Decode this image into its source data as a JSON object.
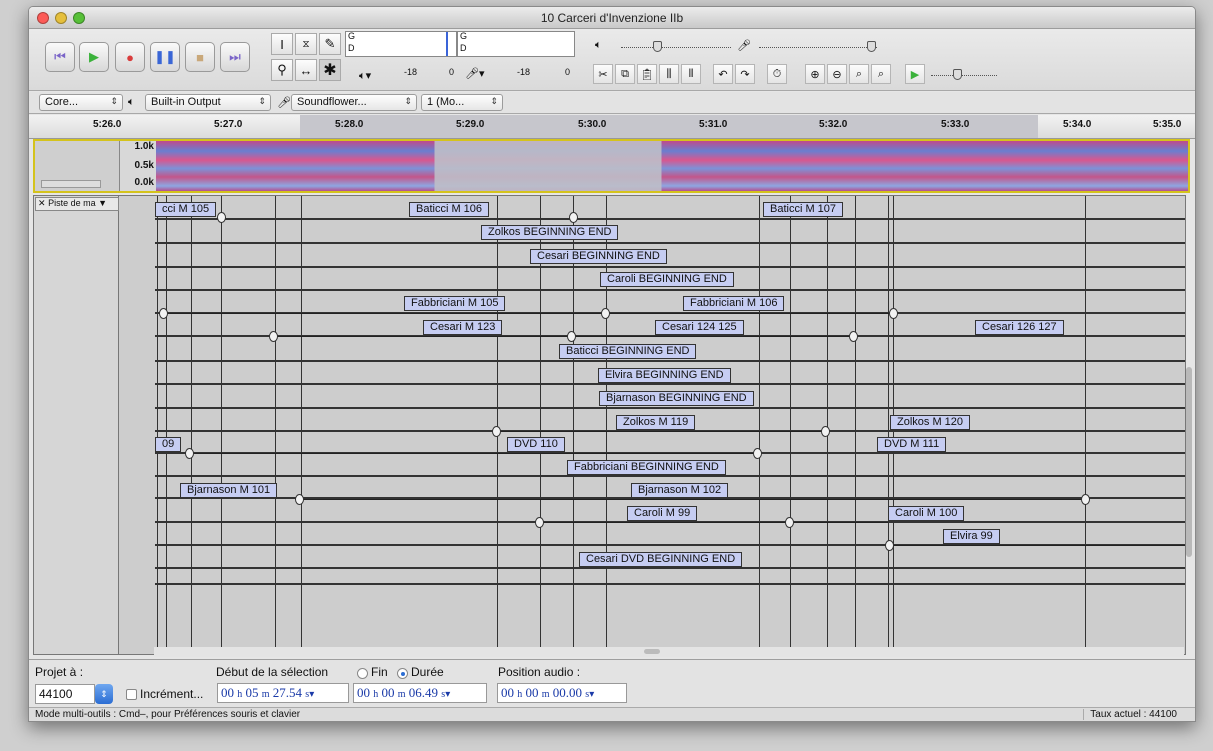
{
  "window": {
    "title": "10 Carceri d'Invenzione IIb"
  },
  "transport": {
    "skip_start": "skip-to-start",
    "play": "play",
    "record": "record",
    "pause": "pause",
    "stop": "stop",
    "skip_end": "skip-to-end"
  },
  "meters": {
    "play_meter_labels": [
      "G",
      "D"
    ],
    "record_meter_labels": [
      "G",
      "D"
    ],
    "play_scale": [
      "-18",
      "0"
    ],
    "record_scale": [
      "-18",
      "0"
    ]
  },
  "devices": {
    "host": "Core...",
    "output": "Built-in Output",
    "input": "Soundflower...",
    "channels": "1 (Mo..."
  },
  "ruler": {
    "ticks": [
      "5:26.0",
      "5:27.0",
      "5:28.0",
      "5:29.0",
      "5:30.0",
      "5:31.0",
      "5:32.0",
      "5:33.0",
      "5:34.0",
      "5:35.0"
    ]
  },
  "spectrogram": {
    "freq_labels": [
      "1.0k",
      "0.5k",
      "0.0k"
    ]
  },
  "label_track": {
    "name": "Piste de ma",
    "labels": [
      "cci M 105",
      "Baticci M 106",
      "Baticci M 107",
      "Zolkos BEGINNING END",
      "Cesari BEGINNING END",
      "Caroli BEGINNING END",
      "Fabbriciani M 105",
      "Fabbriciani M 106",
      "Cesari M 123",
      "Cesari 124 125",
      "Cesari 126 127",
      "Baticci BEGINNING END",
      "Elvira BEGINNING END",
      "Bjarnason BEGINNING END",
      "Zolkos M 119",
      "Zolkos M 120",
      "09",
      "DVD 110",
      "DVD M 111",
      "Fabbriciani BEGINNING END",
      "Bjarnason M 101",
      "Bjarnason M 102",
      "Caroli M 99",
      "Caroli M 100",
      "Elvira 99",
      "Cesari DVD BEGINNING END"
    ]
  },
  "selection_bar": {
    "project_rate_label": "Projet à :",
    "project_rate": "44100",
    "snap_label": "Incrément...",
    "selection_start_label": "Début de la sélection",
    "end_option": "Fin",
    "length_option": "Durée",
    "audio_position_label": "Position audio :",
    "start_time": {
      "h": "00",
      "m": "05",
      "s": "27.54"
    },
    "length_time": {
      "h": "00",
      "m": "00",
      "s": "06.49"
    },
    "audio_time": {
      "h": "00",
      "m": "00",
      "s": "00.00"
    },
    "unit_h": "h",
    "unit_m": "m",
    "unit_s": "s"
  },
  "status": {
    "left": "Mode multi-outils : Cmd–, pour Préférences souris et clavier",
    "right": "Taux actuel : 44100"
  }
}
